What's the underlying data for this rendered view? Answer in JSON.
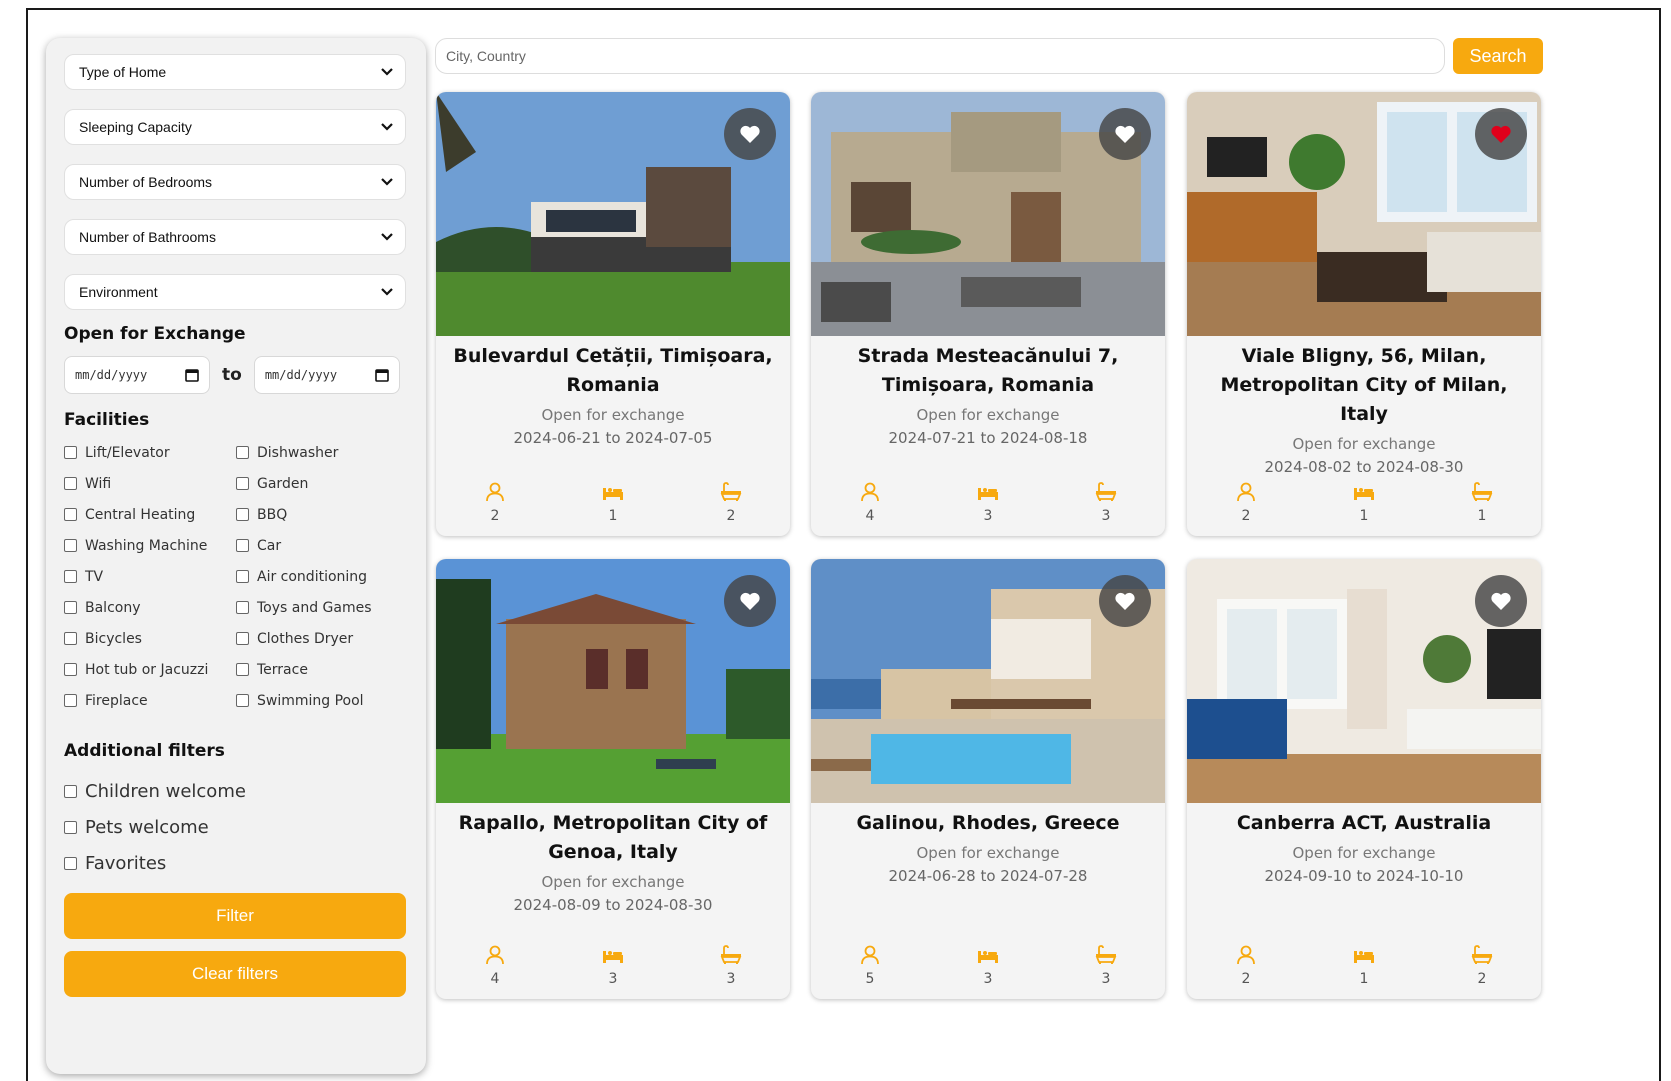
{
  "filters": {
    "selects": [
      "Type of Home",
      "Sleeping Capacity",
      "Number of Bedrooms",
      "Number of Bathrooms",
      "Environment"
    ],
    "exchange": {
      "title": "Open for Exchange",
      "from_placeholder": "mm/dd/yyyy",
      "to_label": "to",
      "to_placeholder": "mm/dd/yyyy"
    },
    "facilities_title": "Facilities",
    "facilities": [
      "Lift/Elevator",
      "Dishwasher",
      "Wifi",
      "Garden",
      "Central Heating",
      "BBQ",
      "Washing Machine",
      "Car",
      "TV",
      "Air conditioning",
      "Balcony",
      "Toys and Games",
      "Bicycles",
      "Clothes Dryer",
      "Hot tub or Jacuzzi",
      "Terrace",
      "Fireplace",
      "Swimming Pool"
    ],
    "additional_title": "Additional filters",
    "additional": [
      "Children welcome",
      "Pets welcome",
      "Favorites"
    ],
    "filter_button": "Filter",
    "clear_button": "Clear filters"
  },
  "search": {
    "placeholder": "City, Country",
    "button": "Search"
  },
  "colors": {
    "accent": "#f7a90f",
    "favorite": "#e0001b"
  },
  "listings": [
    {
      "title": "Bulevardul Cetății, Timișoara, Romania",
      "status": "Open for exchange",
      "dates": "2024-06-21 to 2024-07-05",
      "guests": "2",
      "beds": "1",
      "baths": "2",
      "favorite": false
    },
    {
      "title": "Strada Mesteacănului 7, Timișoara, Romania",
      "status": "Open for exchange",
      "dates": "2024-07-21 to 2024-08-18",
      "guests": "4",
      "beds": "3",
      "baths": "3",
      "favorite": false
    },
    {
      "title": "Viale Bligny, 56, Milan, Metropolitan City of Milan, Italy",
      "status": "Open for exchange",
      "dates": "2024-08-02 to 2024-08-30",
      "guests": "2",
      "beds": "1",
      "baths": "1",
      "favorite": true
    },
    {
      "title": "Rapallo, Metropolitan City of Genoa, Italy",
      "status": "Open for exchange",
      "dates": "2024-08-09 to 2024-08-30",
      "guests": "4",
      "beds": "3",
      "baths": "3",
      "favorite": false
    },
    {
      "title": "Galinou, Rhodes, Greece",
      "status": "Open for exchange",
      "dates": "2024-06-28 to 2024-07-28",
      "guests": "5",
      "beds": "3",
      "baths": "3",
      "favorite": false
    },
    {
      "title": "Canberra ACT, Australia",
      "status": "Open for exchange",
      "dates": "2024-09-10 to 2024-10-10",
      "guests": "2",
      "beds": "1",
      "baths": "2",
      "favorite": false
    }
  ]
}
